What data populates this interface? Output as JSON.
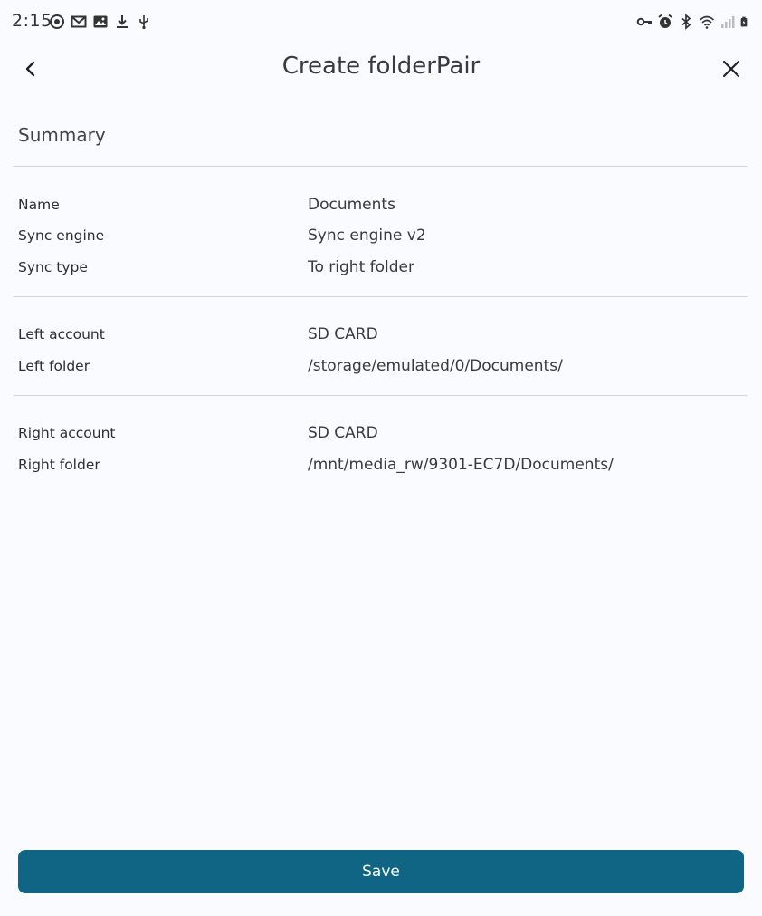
{
  "status_bar": {
    "time": "2:15",
    "left_icons": [
      "sync-icon",
      "gmail-icon",
      "gallery-icon",
      "download-icon",
      "usb-icon"
    ],
    "right_icons": [
      "vpn-key-icon",
      "alarm-icon",
      "bluetooth-icon",
      "wifi-icon",
      "signal-icon",
      "battery-icon"
    ]
  },
  "app_bar": {
    "title": "Create folderPair"
  },
  "summary": {
    "title": "Summary",
    "groups": [
      {
        "rows": [
          {
            "label": "Name",
            "value": "Documents"
          },
          {
            "label": "Sync engine",
            "value": "Sync engine v2"
          },
          {
            "label": "Sync type",
            "value": "To right folder"
          }
        ]
      },
      {
        "rows": [
          {
            "label": "Left account",
            "value": "SD CARD"
          },
          {
            "label": "Left folder",
            "value": "/storage/emulated/0/Documents/"
          }
        ]
      },
      {
        "rows": [
          {
            "label": "Right account",
            "value": "SD CARD"
          },
          {
            "label": "Right folder",
            "value": "/mnt/media_rw/9301-EC7D/Documents/"
          }
        ]
      }
    ]
  },
  "footer": {
    "save_label": "Save"
  },
  "colors": {
    "accent": "#0f6583",
    "background": "#fafbfe",
    "divider": "#d4d6da"
  }
}
